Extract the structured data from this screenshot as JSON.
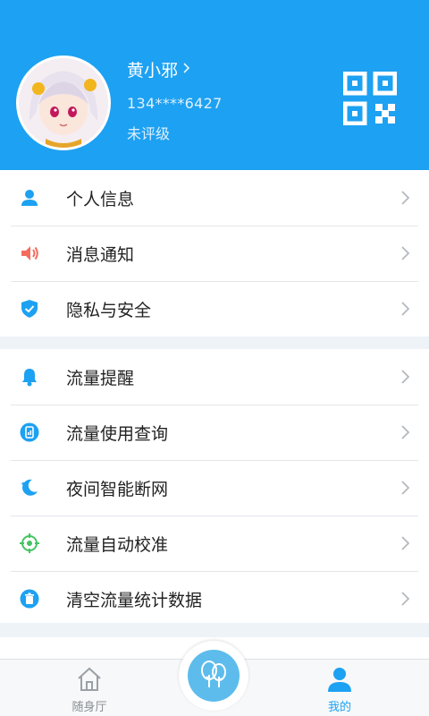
{
  "colors": {
    "accent": "#1da1f2",
    "background": "#eef3f8"
  },
  "profile": {
    "name": "黄小邪",
    "phone": "134****6427",
    "level": "未评级",
    "avatar_icon": "anime-avatar",
    "qr_icon": "qr-code-icon"
  },
  "group_account": [
    {
      "label": "个人信息",
      "icon": "person-icon"
    },
    {
      "label": "消息通知",
      "icon": "speaker-icon"
    },
    {
      "label": "隐私与安全",
      "icon": "shield-check-icon"
    }
  ],
  "group_traffic": [
    {
      "label": "流量提醒",
      "icon": "bell-icon"
    },
    {
      "label": "流量使用查询",
      "icon": "phone-chart-icon"
    },
    {
      "label": "夜间智能断网",
      "icon": "moon-icon"
    },
    {
      "label": "流量自动校准",
      "icon": "target-icon"
    },
    {
      "label": "清空流量统计数据",
      "icon": "trash-icon"
    }
  ],
  "tabbar": {
    "home_label": "随身厅",
    "center_icon": "trees-icon",
    "mine_label": "我的"
  }
}
